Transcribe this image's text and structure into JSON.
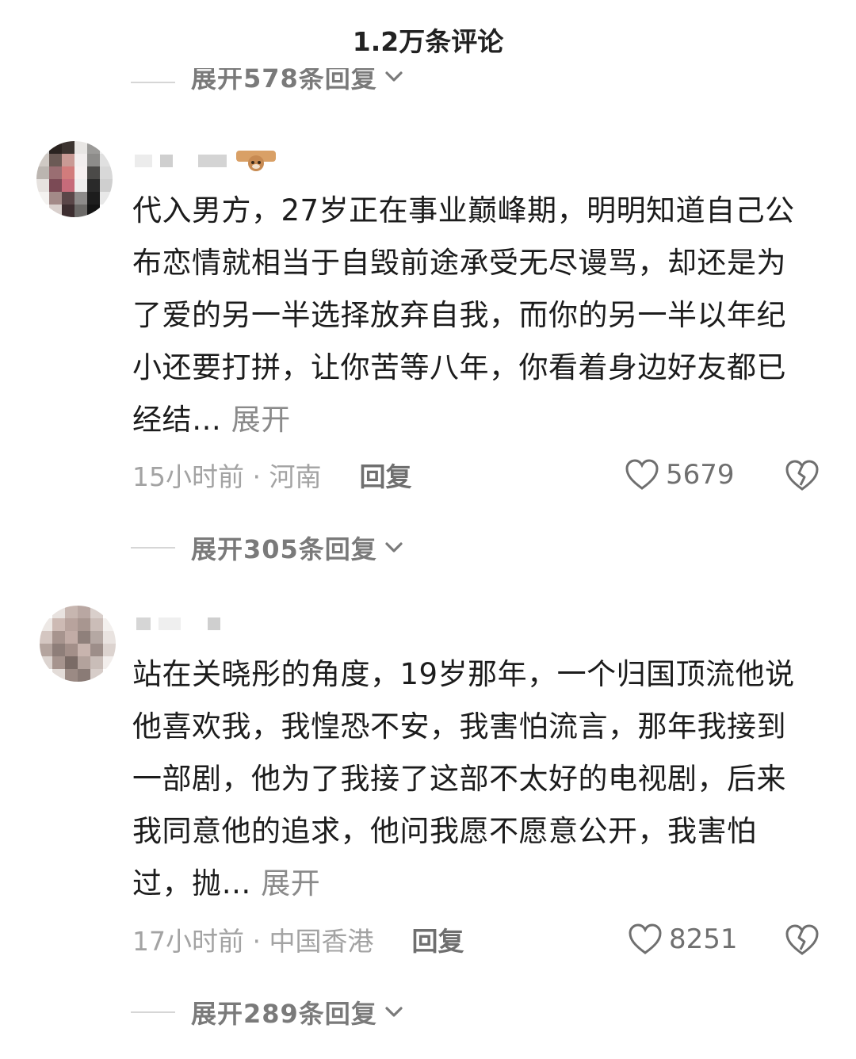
{
  "header": {
    "title": "1.2万条评论"
  },
  "top_expander": {
    "label": "展开578条回复"
  },
  "comments": [
    {
      "text": "代入男方，27岁正在事业巅峰期，明明知道自己公布恋情就相当于自毁前途承受无尽谩骂，却还是为了爱的另一半选择放弃自我，而你的另一半以年纪小还要打拼，让你苦等八年，你看着身边好友都已经结…",
      "more_label": "展开",
      "time_location": "15小时前 · 河南",
      "reply_label": "回复",
      "likes": "5679",
      "replies_expander": "展开305条回复",
      "avatar_colors": [
        "#d8d8d8",
        "#2a2320",
        "#3c3430",
        "#e8e6e4",
        "#9b9a98",
        "#f0f0f0",
        "#cfc9c4",
        "#6b5a55",
        "#c99a95",
        "#f2eeee",
        "#8d8c8a",
        "#e0e0e0",
        "#bbb5b0",
        "#9a6e72",
        "#d27c7c",
        "#f6f0f0",
        "#4b4a48",
        "#d8d8d8",
        "#e6e2df",
        "#7b4a55",
        "#c76b7a",
        "#efeeee",
        "#2a2a2a",
        "#cfcfcf",
        "#f4f2f0",
        "#a38a88",
        "#5a4648",
        "#8d8b8a",
        "#1d1d1d",
        "#e8e8e8",
        "#ffffff",
        "#d9d0cd",
        "#3d2e30",
        "#6c6a68",
        "#141414",
        "#ffffff"
      ]
    },
    {
      "text": "站在关晓彤的角度，19岁那年，一个归国顶流他说他喜欢我，我惶恐不安，我害怕流言，那年我接到一部剧，他为了我接了这部不太好的电视剧，后来我同意他的追求，他问我愿不愿意公开，我害怕过，抛…",
      "more_label": "展开",
      "time_location": "17小时前 · 中国香港",
      "reply_label": "回复",
      "likes": "8251",
      "replies_expander": "展开289条回复",
      "avatar_colors": [
        "#ffffff",
        "#e8e2df",
        "#c7b6b0",
        "#b9a7a2",
        "#d9cfcb",
        "#ffffff",
        "#ede8e5",
        "#cdbab4",
        "#b8a39d",
        "#a89690",
        "#cbbdb8",
        "#f3f0ee",
        "#d4c6c1",
        "#a7948e",
        "#c2aca6",
        "#8f807b",
        "#b5a8a3",
        "#e9e3e0",
        "#b4a49e",
        "#8e7e79",
        "#a38f89",
        "#c8b4ae",
        "#9d8e89",
        "#dcd3cf",
        "#dcd4d0",
        "#a6948e",
        "#7a6b66",
        "#b3a29c",
        "#c9bdb8",
        "#f2eeec",
        "#ffffff",
        "#e3dcd8",
        "#9b8a84",
        "#8a7b76",
        "#d7cdc9",
        "#ffffff"
      ]
    }
  ]
}
